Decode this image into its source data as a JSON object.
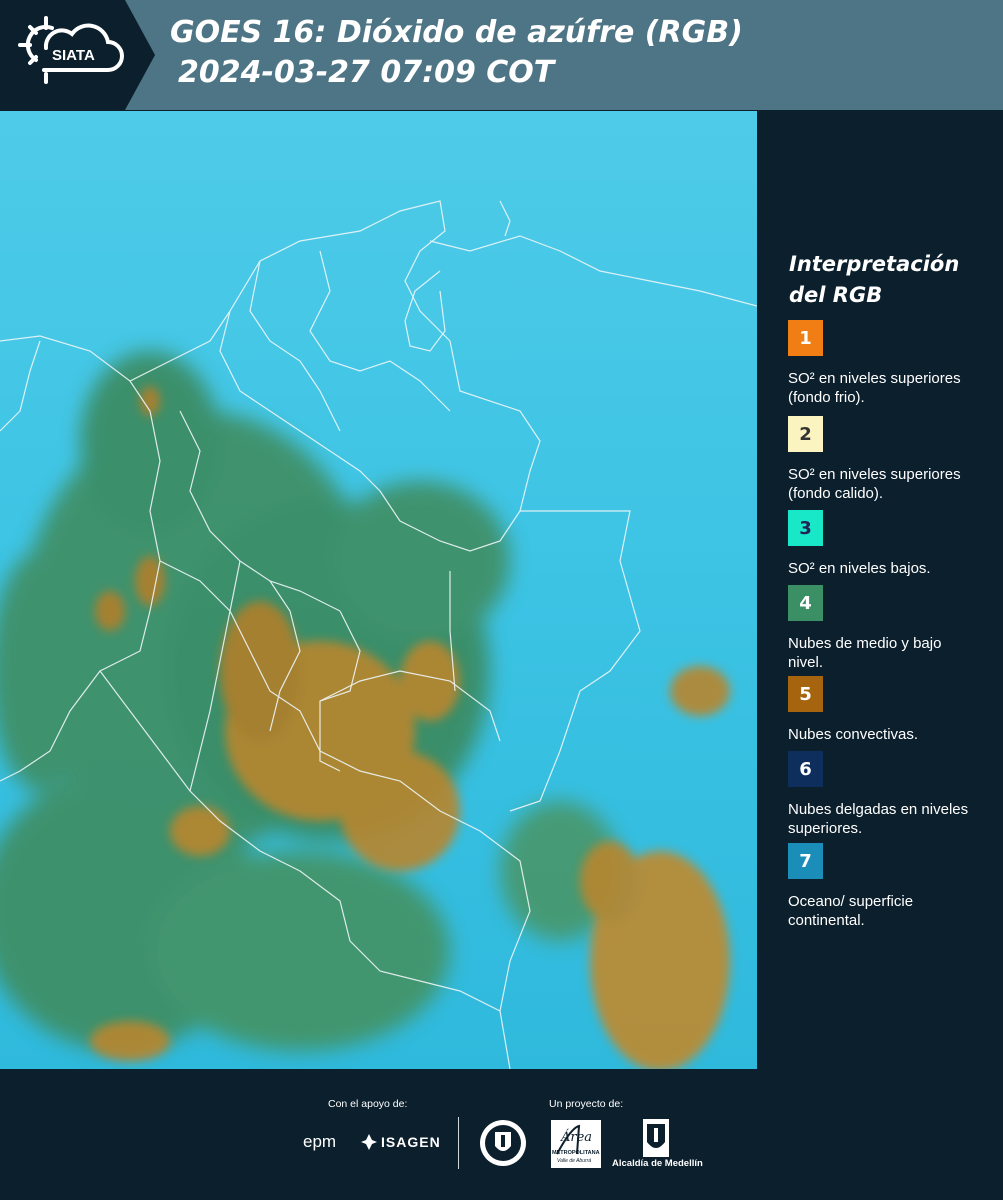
{
  "header": {
    "logo_text": "SIATA",
    "title_line1": "GOES 16: Dióxido de azúfre (RGB)",
    "title_line2": "2024-03-27 07:09 COT"
  },
  "legend": {
    "title_line1": "Interpretación",
    "title_line2": "del RGB",
    "items": [
      {
        "number": "1",
        "color": "#f07e14",
        "text": "SO² en niveles superiores (fondo frio)."
      },
      {
        "number": "2",
        "color": "#fbf4c0",
        "text": "SO² en niveles superiores (fondo calido)."
      },
      {
        "number": "3",
        "color": "#19e8c8",
        "text": "SO² en niveles bajos."
      },
      {
        "number": "4",
        "color": "#3a8f64",
        "text": "Nubes de medio y bajo nivel."
      },
      {
        "number": "5",
        "color": "#a7640e",
        "text": "Nubes convectivas."
      },
      {
        "number": "6",
        "color": "#0e2e5e",
        "text": "Nubes delgadas en niveles superiores."
      },
      {
        "number": "7",
        "color": "#1a8db8",
        "text": "Oceano/ superficie continental."
      }
    ]
  },
  "footer": {
    "support_label": "Con el apoyo de:",
    "project_label": "Un proyecto de:",
    "epm": "epm",
    "isagen": "ISAGEN",
    "area_text": "Área",
    "area_sub": "METROPOLITANA",
    "area_sub2": "Valle de Aburrá",
    "alcaldia": "Alcaldía de Medellín"
  },
  "colors": {
    "header_bg": "#4e7585",
    "panel_bg": "#0c1f2c",
    "map_cyan": "#3cc6e6",
    "map_orange": "#b8862e",
    "map_green": "#3f8a5a"
  }
}
